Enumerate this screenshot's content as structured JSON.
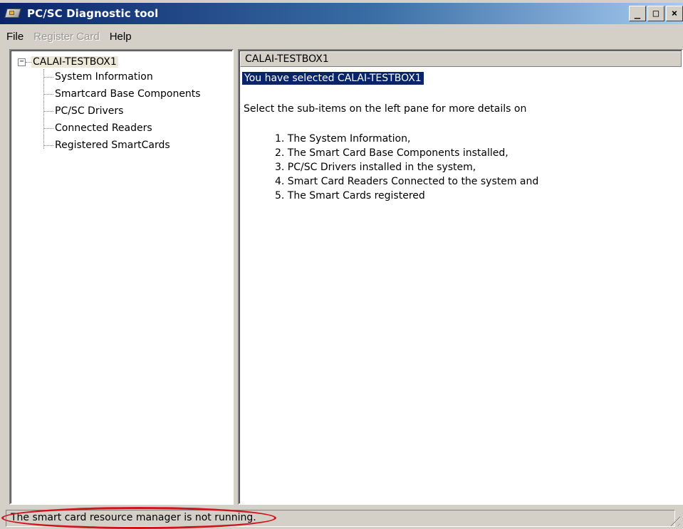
{
  "window": {
    "title": "PC/SC Diagnostic tool",
    "controls": {
      "minimize": "_",
      "maximize": "□",
      "close": "×"
    }
  },
  "menu": {
    "items": [
      {
        "label": "File",
        "enabled": true
      },
      {
        "label": "Register Card",
        "enabled": false
      },
      {
        "label": "Help",
        "enabled": true
      }
    ]
  },
  "tree": {
    "root": {
      "label": "CALAI-TESTBOX1",
      "expander": "⊟",
      "selected": true
    },
    "children": [
      {
        "label": "System Information"
      },
      {
        "label": "Smartcard Base Components"
      },
      {
        "label": "PC/SC Drivers"
      },
      {
        "label": "Connected Readers"
      },
      {
        "label": "Registered SmartCards"
      }
    ]
  },
  "content": {
    "header": "CALAI-TESTBOX1",
    "selected_line": "You have selected CALAI-TESTBOX1",
    "intro": "Select the sub-items on the left pane for more details on",
    "items": [
      "1. The System Information,",
      "2. The Smart Card Base Components installed,",
      "3. PC/SC Drivers installed in the system,",
      "4. Smart Card Readers Connected to the system and",
      "5. The Smart Cards registered"
    ]
  },
  "status": {
    "text": "The smart card resource manager is not running.",
    "highlight_color": "#d0141e"
  },
  "colors": {
    "titlebar_start": "#0a246a",
    "titlebar_end": "#a6caf0",
    "selection": "#0a246a",
    "face": "#d4d0c8"
  }
}
